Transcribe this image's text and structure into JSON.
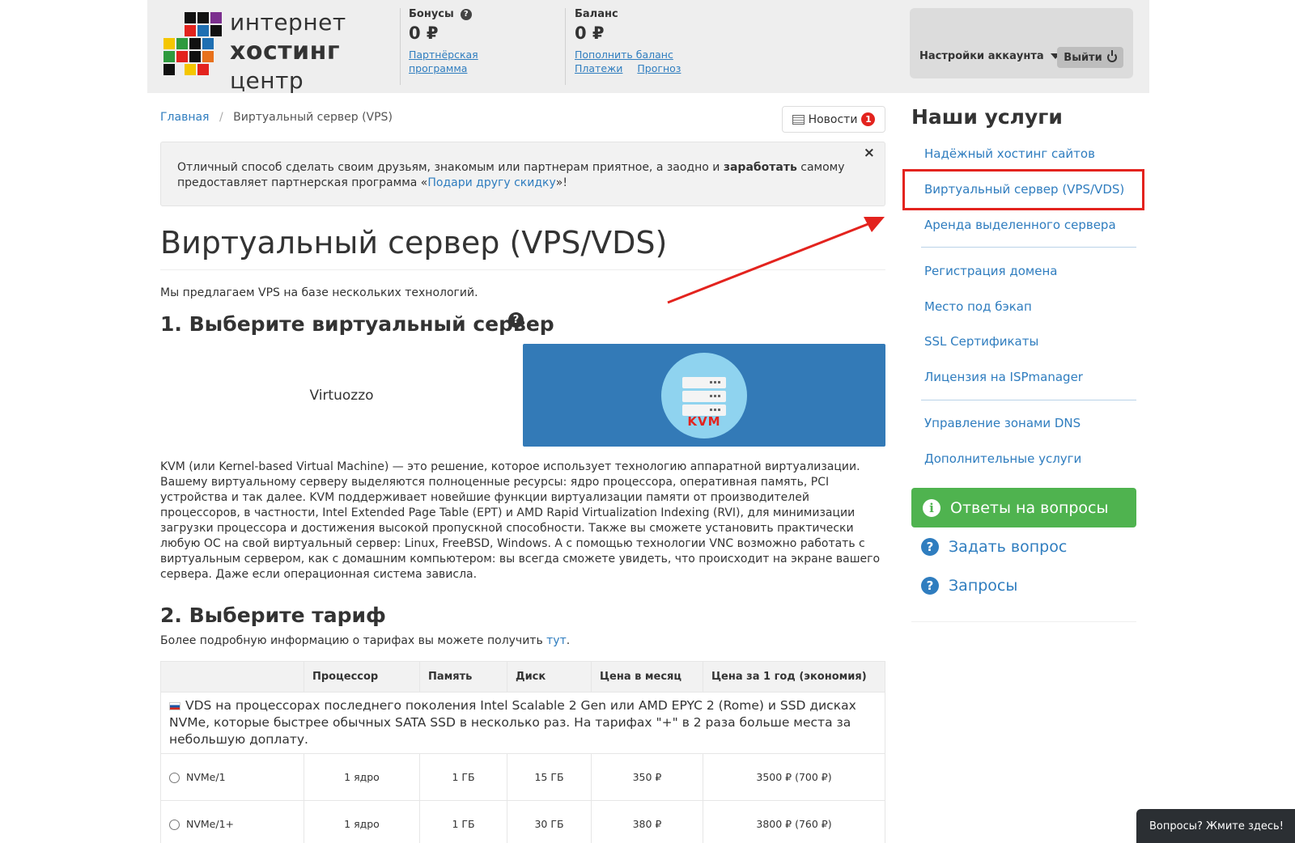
{
  "header": {
    "logo": {
      "line1": "интернет",
      "line2": "хостинг",
      "line3": "центр"
    },
    "bonuses": {
      "label": "Бонусы",
      "value": "0 ₽",
      "link": "Партнёрская программа"
    },
    "balance": {
      "label": "Баланс",
      "value": "0 ₽",
      "topup": "Пополнить баланс",
      "payments": "Платежи",
      "forecast": "Прогноз"
    },
    "account_settings": "Настройки аккаунта",
    "logout": "Выйти"
  },
  "breadcrumb": {
    "home": "Главная",
    "separator": "/",
    "current": "Виртуальный сервер (VPS)"
  },
  "news": {
    "label": "Новости",
    "count": "1"
  },
  "alert": {
    "text1": "Отличный способ сделать своим друзьям, знакомым или партнерам приятное, а заодно и ",
    "bold": "заработать",
    "text2": " самому предоставляет партнерская программа «",
    "link": "Подари другу скидку",
    "text3": "»!",
    "close": "×"
  },
  "main": {
    "title": "Виртуальный сервер (VPS/VDS)",
    "intro": "Мы предлагаем VPS на базе нескольких технологий.",
    "step1": "1. Выберите виртуальный сервер",
    "virtuozzo": "Virtuozzo",
    "kvm_label": "KVM",
    "kvm_desc": "KVM (или Kernel-based Virtual Machine) — это решение, которое использует технологию аппаратной виртуализации. Вашему виртуальному серверу выделяются полноценные ресурсы: ядро процессора, оперативная память, PCI устройства и так далее. KVM поддерживает новейшие функции виртуализации памяти от производителей процессоров, в частности, Intel Extended Page Table (EPT) и AMD Rapid Virtualization Indexing (RVI), для минимизации загрузки процессора и достижения высокой пропускной способности. Также вы сможете установить практически любую ОС на свой виртуальный сервер: Linux, FreeBSD, Windows. А с помощью технологии VNC возможно работать с виртуальным сервером, как с домашним компьютером: вы всегда сможете увидеть, что происходит на экране вашего сервера. Даже если операционная система зависла.",
    "step2": "2. Выберите тариф",
    "step2_note": "Более подробную информацию о тарифах вы можете получить ",
    "step2_link": "тут",
    "step2_end": "."
  },
  "table": {
    "headers": [
      "",
      "Процессор",
      "Память",
      "Диск",
      "Цена в месяц",
      "Цена за 1 год (экономия)"
    ],
    "group_desc": "VDS на процессорах последнего поколения Intel Scalable 2 Gen или AMD EPYC 2 (Rome) и SSD дисках NVMe, которые быстрее обычных SATA SSD в несколько раз. На тарифах \"+\" в 2 раза больше места за небольшую доплату.",
    "rows": [
      {
        "name": "NVMe/1",
        "cpu": "1 ядро",
        "ram": "1 ГБ",
        "disk": "15 ГБ",
        "month": "350 ₽",
        "year": "3500 ₽ (700 ₽)"
      },
      {
        "name": "NVMe/1+",
        "cpu": "1 ядро",
        "ram": "1 ГБ",
        "disk": "30 ГБ",
        "month": "380 ₽",
        "year": "3800 ₽ (760 ₽)"
      }
    ]
  },
  "sidebar": {
    "title": "Наши услуги",
    "items": [
      "Надёжный хостинг сайтов",
      "Виртуальный сервер (VPS/VDS)",
      "Аренда выделенного сервера",
      "Регистрация домена",
      "Место под бэкап",
      "SSL Сертификаты",
      "Лицензия на ISPmanager",
      "Управление зонами DNS",
      "Дополнительные услуги"
    ],
    "faq": "Ответы на вопросы",
    "ask": "Задать вопрос",
    "requests": "Запросы"
  },
  "chat": "Вопросы? Жмите здесь!",
  "colors": {
    "link": "#2f7dbf",
    "kvm_tile": "#337ab7",
    "faq_green": "#4fb34f",
    "highlight_red": "#e3231e"
  }
}
